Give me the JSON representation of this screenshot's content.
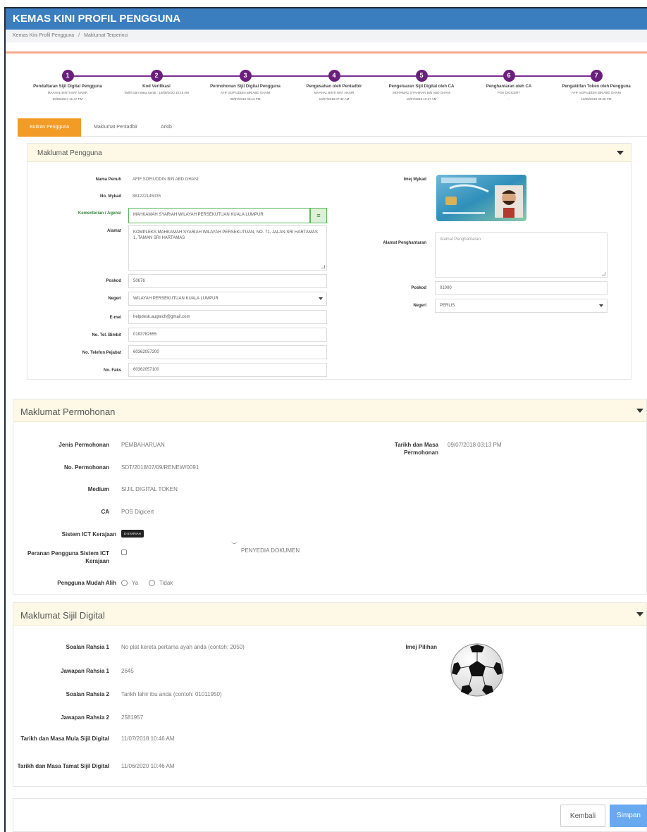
{
  "header": {
    "title": "KEMAS KINI PROFIL PENGGUNA"
  },
  "breadcrumb": {
    "items": [
      "Kemas Kini Profil Pengguna",
      "Maklumat Terperinci"
    ],
    "separator": "/"
  },
  "steps": [
    {
      "num": "1",
      "title": "Pendaftaran Sijil Digital Pengguna",
      "l1": "MAAHAL BINTI MAT NASIR",
      "l2": "20/06/2017 11:47 PM"
    },
    {
      "num": "2",
      "title": "Kod Verifikasi",
      "l1": "Tarikh dan Masa tamat : 15/08/2020 10:16 AM",
      "l2": ""
    },
    {
      "num": "3",
      "title": "Permohonan Sijil Digital Pengguna",
      "l1": "AFIF SOFIUDDIN BIN ABD GHANI",
      "l2": "09/07/2018 03:13 PM"
    },
    {
      "num": "4",
      "title": "Pengesahan oleh Pentadbir",
      "l1": "MAAHAL BINTI MAT NASIR",
      "l2": "10/07/2018 07:32 AM"
    },
    {
      "num": "5",
      "title": "Pengeluaran Sijil Digital oleh CA",
      "l1": "MOHAMAD SYAHIRAN BIN ABD GHANI",
      "l2": "10/07/2018 10:37 AM"
    },
    {
      "num": "6",
      "title": "Penghantaran oleh CA",
      "l1": "POS DIGICERT",
      "l2": "-"
    },
    {
      "num": "7",
      "title": "Pengaktifan Token oleh Pengguna",
      "l1": "AFIF SOFIUDDIN BIN ABD GHANI",
      "l2": "12/06/2019 03:48 PM"
    }
  ],
  "tabs": [
    "Butiran Pengguna",
    "Maklumat Pentadbir",
    "Arkib"
  ],
  "user_panel": {
    "title": "Maklumat Pengguna",
    "labels": {
      "nama": "Nama Penuh",
      "mykad": "No. Mykad",
      "agensi": "Kementerian / Agensi",
      "alamat": "Alamat",
      "poskod": "Poskod",
      "negeri": "Negeri",
      "emel": "E-mel",
      "tel_bimbit": "No. Tel. Bimbit",
      "tel_pejabat": "No. Telefon Pejabat",
      "faks": "No. Faks",
      "imej_mykad": "Imej Mykad",
      "alamat_penghantaran": "Alamat Penghantaran",
      "poskod2": "Poskod",
      "negeri2": "Negeri"
    },
    "values": {
      "nama": "AFIF SOFIUDDIN BIN ABD GHANI",
      "mykad": "881222145035",
      "agensi": "MAHKAMAH SYARIAH WILAYAH PERSEKUTUAN KUALA LUMPUR",
      "alamat": "KOMPLEKS MAHKAMAH SYARIAH WILAYAH PERSEKUTUAN, NO. 71, JALAN SRI HARTAMAS 1, TAMAN SRI HARTAMAS",
      "poskod": "50676",
      "negeri": "WILAYAH PERSEKUTUAN KUALA LUMPUR",
      "emel": "helpdesk.augtech@gmail.com",
      "tel_bimbit": "0193782655",
      "tel_pejabat": "60362057200",
      "faks": "60362057100",
      "alamat_penghantaran_placeholder": "Alamat Penghantaran",
      "poskod2": "01000",
      "negeri2": "PERLIS"
    }
  },
  "permohonan_panel": {
    "title": "Maklumat Permohonan",
    "labels": {
      "jenis": "Jenis Permohonan",
      "no": "No. Permohonan",
      "medium": "Medium",
      "ca": "CA",
      "sistem": "Sistem ICT Kerajaan",
      "peranan": "Peranan Pengguna Sistem ICT Kerajaan",
      "mudah_alih": "Pengguna Mudah Alih",
      "tarikh": "Tarikh dan Masa Permohonan"
    },
    "values": {
      "jenis": "PEMBAHARUAN",
      "no": "SDT/2018/07/09/RENEW/0091",
      "medium": "SIJIL DIGITAL TOKEN",
      "ca": "POS Digicert",
      "sistem_badge": "E-SYARIAH",
      "peranan": "PENYEDIA DOKUMEN",
      "ya": "Ya",
      "tidak": "Tidak",
      "tarikh": "09/07/2018 03:13 PM"
    }
  },
  "sijil_panel": {
    "title": "Maklumat Sijil Digital",
    "labels": {
      "soalan1": "Soalan Rahsia 1",
      "jawapan1": "Jawapan Rahsia 1",
      "soalan2": "Soalan Rahsia 2",
      "jawapan2": "Jawapan Rahsia 2",
      "mula": "Tarikh dan Masa Mula Sijil Digital",
      "tamat": "Tarikh dan Masa Tamat Sijil Digital",
      "imej": "Imej Pilihan"
    },
    "values": {
      "soalan1": "No plat kereta pertama ayah anda (contoh: 2050)",
      "jawapan1": "2645",
      "soalan2": "Tarikh lahir ibu anda (contoh: 01011950)",
      "jawapan2": "2581957",
      "mula": "11/07/2018 10:46 AM",
      "tamat": "11/06/2020 10:46 AM"
    }
  },
  "footer": {
    "kembali": "Kembali",
    "simpan": "Simpan"
  },
  "colors": {
    "header": "#3a7ec0",
    "active_tab": "#f29b26",
    "step": "#6a1f7c",
    "panel_head": "#fdf9e6",
    "primary_button": "#68a9f0"
  }
}
